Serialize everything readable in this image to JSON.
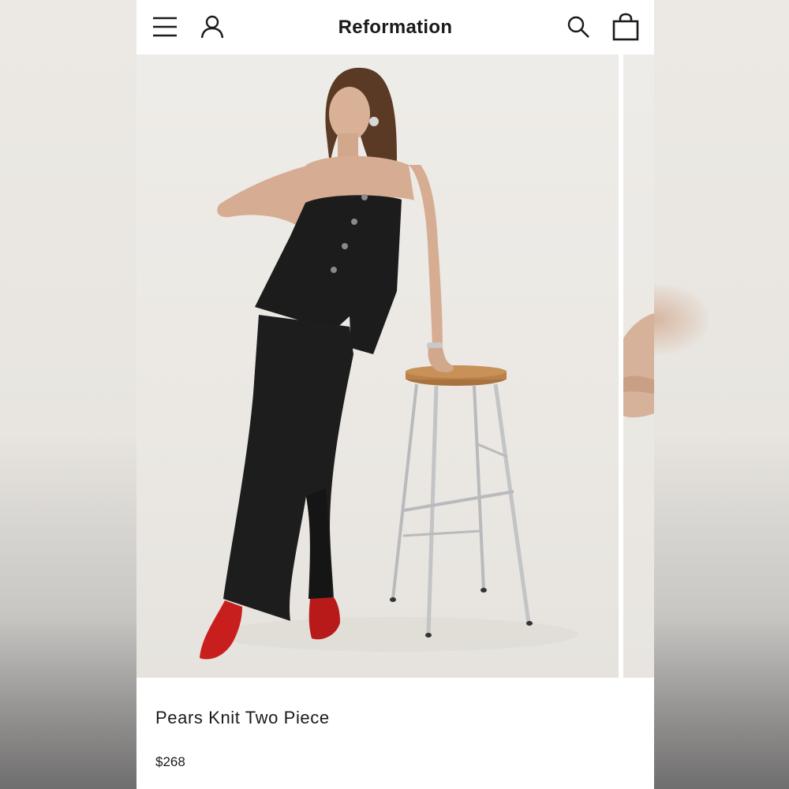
{
  "header": {
    "brand": "Reformation",
    "icons": [
      "menu-icon",
      "account-icon",
      "search-icon",
      "bag-icon"
    ]
  },
  "gallery": {
    "main_image": "model-in-black-strapless-two-piece-leaning-on-stool",
    "next_image": "partial-arm-preview"
  },
  "product": {
    "name": "Pears Knit Two Piece",
    "price": "$268"
  },
  "colors": {
    "text": "#1a1a1a",
    "background": "#ffffff",
    "photo_bg": "#ebe8e3"
  }
}
